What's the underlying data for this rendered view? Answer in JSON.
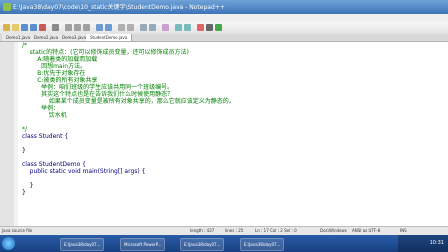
{
  "window": {
    "title": "E:\\Java38\\day07\\code\\10_static关键字\\StudentDemo.java - Notepad++"
  },
  "watermark": "优酷",
  "tabs": [
    {
      "label": "Demo1.java"
    },
    {
      "label": "Demo2.java"
    },
    {
      "label": "Demo3.java"
    },
    {
      "label": "StudentDemo.java"
    }
  ],
  "code_lines": [
    "/*",
    "    static的特点：(它可以修饰成员变量，还可以修饰成员方法)",
    "        A:随着类的加载而加载",
    "          回想main方法。",
    "        B:优先于对象存在",
    "        C:被类的所有对象共享",
    "          举例：咱们班级的学生应该共用同一个班级编号。",
    "          其实这个特点也是在告诉我们什么时候使用静态？",
    "              如果某个成员变量是被所有对象共享的，那么它就应该定义为静态的。",
    "          举例：",
    "              饮水机",
    "",
    "*/",
    "class Student {",
    "",
    "}",
    "",
    "class StudentDemo {",
    "    public static void main(String[] args) {",
    "",
    "    }",
    "}"
  ],
  "status": {
    "file_type": "Java source file",
    "length": "length : 437",
    "lines": "lines : 25",
    "position": "Ln : 17  Col : 2  Sel : 0",
    "eol": "Dos\\Windows",
    "encoding": "ANSI as UTF-8",
    "mode": "INS"
  },
  "taskbar": {
    "items": [
      "E:\\Java38\\day07...",
      "Microsoft PowerP...",
      "E:\\Java38\\day07...",
      "E:\\Java38\\day07..."
    ],
    "time": "10:31"
  }
}
